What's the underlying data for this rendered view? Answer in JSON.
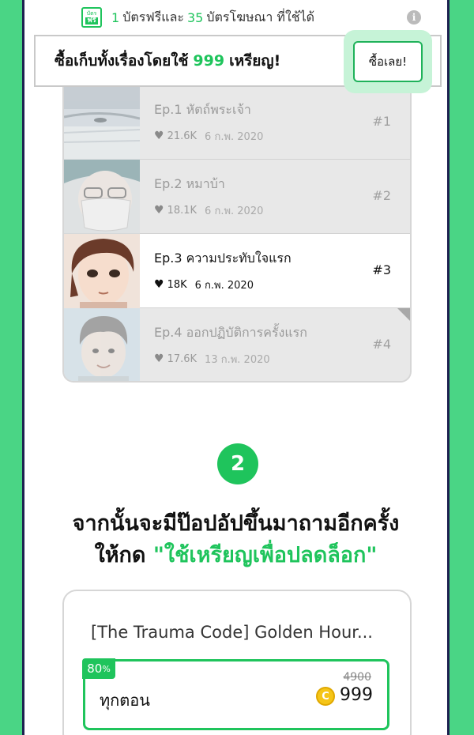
{
  "ticket_info": {
    "badge_top": "บัตร",
    "badge_bottom": "ฟรี",
    "free_count": "1",
    "free_label": "บัตรฟรีและ",
    "ad_count": "35",
    "ad_label": "บัตรโฆษณา ที่ใช้ได้",
    "info_icon": "i"
  },
  "buy_bar": {
    "text_before": "ซื้อเก็บทั้งเรื่องโดยใช้",
    "coins": "999",
    "text_after": "เหรียญ!",
    "button_label": "ซื้อเลย!"
  },
  "episodes": [
    {
      "title": "Ep.1 หัตถ์พระเจ้า",
      "likes": "21.6K",
      "date": "6 ก.พ. 2020",
      "number": "#1",
      "state": "locked"
    },
    {
      "title": "Ep.2 หมาบ้า",
      "likes": "18.1K",
      "date": "6 ก.พ. 2020",
      "number": "#2",
      "state": "locked"
    },
    {
      "title": "Ep.3 ความประทับใจแรก",
      "likes": "18K",
      "date": "6 ก.พ. 2020",
      "number": "#3",
      "state": "active"
    },
    {
      "title": "Ep.4 ออกปฏิบัติการครั้งแรก",
      "likes": "17.6K",
      "date": "13 ก.พ. 2020",
      "number": "#4",
      "state": "locked"
    }
  ],
  "step": {
    "number": "2",
    "line1": "จากนั้นจะมีป๊อปอัปขึ้นมาถามอีกครั้ง",
    "line2_prefix": "ให้กด",
    "line2_highlight": "\"ใช้เหรียญเพื่อปลดล็อก\""
  },
  "popup": {
    "title": "[The Trauma Code] Golden Hour...",
    "discount": "80",
    "discount_unit": "%",
    "option_label": "ทุกตอน",
    "old_price": "4900",
    "coin_symbol": "C",
    "new_price": "999"
  },
  "colors": {
    "accent": "#1fc45c",
    "background": "#4ad585",
    "frame_border": "#1d2150"
  },
  "icons": [
    "info-icon",
    "heart-icon",
    "coin-icon"
  ]
}
